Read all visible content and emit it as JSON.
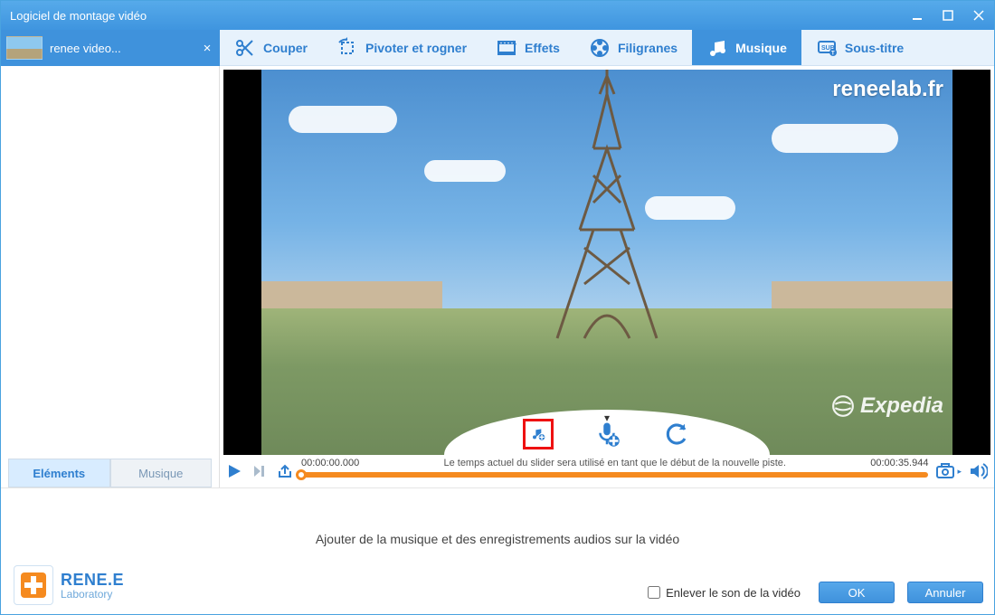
{
  "window": {
    "title": "Logiciel de montage vidéo"
  },
  "file_chip": {
    "name": "renee video..."
  },
  "toolbar": {
    "tabs": [
      {
        "label": "Couper"
      },
      {
        "label": "Pivoter et rogner"
      },
      {
        "label": "Effets"
      },
      {
        "label": "Filigranes"
      },
      {
        "label": "Musique"
      },
      {
        "label": "Sous-titre"
      }
    ],
    "active_index": 4
  },
  "side_tabs": {
    "items": [
      {
        "label": "Eléments"
      },
      {
        "label": "Musique"
      }
    ],
    "active_index": 0
  },
  "preview": {
    "watermark_url": "reneelab.fr",
    "watermark_brand": "Expedia"
  },
  "playback": {
    "current_time": "00:00:00.000",
    "slider_hint": "Le temps actuel du slider sera utilisé en tant que le début de la nouvelle piste.",
    "total_time": "00:00:35.944"
  },
  "bottom": {
    "message": "Ajouter de la musique et des enregistrements audios sur la vidéo",
    "mute_label": "Enlever le son de la vidéo",
    "ok_label": "OK",
    "cancel_label": "Annuler"
  },
  "brand": {
    "line1": "RENE.E",
    "line2": "Laboratory"
  },
  "colors": {
    "accent": "#3f92dc",
    "accent_light": "#e7f2fc",
    "orange": "#f58a1f"
  }
}
